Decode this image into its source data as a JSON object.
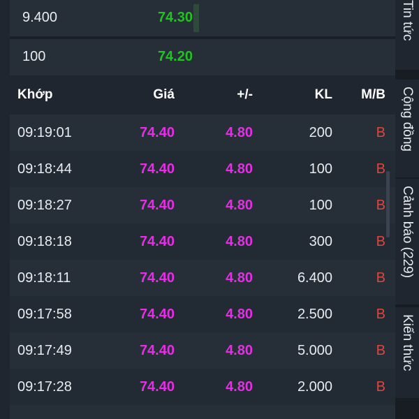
{
  "order_book": [
    {
      "volume": "9.400",
      "price": "74.30"
    },
    {
      "volume": "100",
      "price": "74.20"
    }
  ],
  "header": {
    "time": "Khớp",
    "price": "Giá",
    "change": "+/-",
    "volume": "KL",
    "side": "M/B"
  },
  "trades": [
    {
      "time": "09:19:01",
      "price": "74.40",
      "change": "4.80",
      "volume": "200",
      "side": "B"
    },
    {
      "time": "09:18:44",
      "price": "74.40",
      "change": "4.80",
      "volume": "100",
      "side": "B"
    },
    {
      "time": "09:18:27",
      "price": "74.40",
      "change": "4.80",
      "volume": "100",
      "side": "B"
    },
    {
      "time": "09:18:18",
      "price": "74.40",
      "change": "4.80",
      "volume": "300",
      "side": "B"
    },
    {
      "time": "09:18:11",
      "price": "74.40",
      "change": "4.80",
      "volume": "6.400",
      "side": "B"
    },
    {
      "time": "09:17:58",
      "price": "74.40",
      "change": "4.80",
      "volume": "2.500",
      "side": "B"
    },
    {
      "time": "09:17:49",
      "price": "74.40",
      "change": "4.80",
      "volume": "5.000",
      "side": "B"
    },
    {
      "time": "09:17:28",
      "price": "74.40",
      "change": "4.80",
      "volume": "2.000",
      "side": "B"
    }
  ],
  "side_tabs": [
    "Tin tức",
    "Cộng đồng",
    "Cảnh báo (229)",
    "Kiến thức"
  ],
  "colors": {
    "up_green": "#1fc41f",
    "ceiling_magenta": "#e62ee6",
    "buy_red": "#e0463c",
    "background": "#1f2630"
  }
}
